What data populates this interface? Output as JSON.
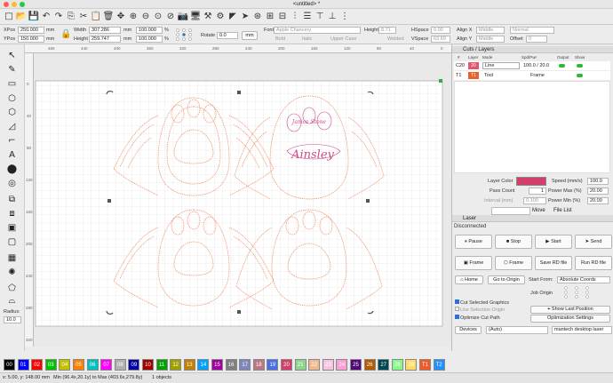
{
  "window": {
    "title": "<untitled> *"
  },
  "props": {
    "xpos_label": "XPos",
    "xpos": "250.000",
    "ypos_label": "YPos",
    "ypos": "150.000",
    "mm": "mm",
    "width_label": "Width",
    "width": "307.286",
    "height_label": "Height",
    "height": "259.747",
    "sx": "100.000",
    "sy": "100.000",
    "pct": "%",
    "rotate_label": "Rotate",
    "rotate": "0.0",
    "mm_btn": "mm",
    "font_label": "Font",
    "font": "Apple Chancery",
    "fheight_label": "Height",
    "fheight": "8.71",
    "bold": "Bold",
    "italic": "Italic",
    "upper": "Upper Case",
    "welded": "Welded",
    "hspace_label": "HSpace",
    "hspace": "0.00",
    "vspace_label": "VSpace",
    "vspace": "63.69",
    "alignx_label": "Align X",
    "alignx": "Middle",
    "aligny_label": "Align Y",
    "aligny": "Middle",
    "normal": "Normal",
    "offset_label": "Offset",
    "offset": "0"
  },
  "left": {
    "radius_label": "Radius:",
    "radius": "10.0"
  },
  "ruler": {
    "top": [
      "480",
      "440",
      "400",
      "360",
      "320",
      "280",
      "240",
      "200",
      "160",
      "120",
      "80",
      "40",
      "0"
    ],
    "left": [
      "0",
      "40",
      "80",
      "120",
      "160",
      "200",
      "240",
      "280",
      "320"
    ]
  },
  "layers": {
    "title": "Cuts / Layers",
    "headers": [
      "#",
      "Layer",
      "Mode",
      "Spd/Pwr",
      "Output",
      "Show"
    ],
    "rows": [
      {
        "num": "C20",
        "layer": "20",
        "mode": "Line",
        "spdpwr": "100.0 / 20.0",
        "color": "#e0586e"
      },
      {
        "num": "T1",
        "layer": "T1",
        "mode": "Tool",
        "spdpwr": "Frame",
        "color": "#e8602a"
      }
    ],
    "layer_color_label": "Layer Color",
    "pass_count_label": "Pass Count",
    "pass_count": "1",
    "interval_label": "Interval (mm)",
    "interval": "0.100",
    "speed_label": "Speed (mm/s)",
    "speed": "100.0",
    "pmax_label": "Power Max (%)",
    "pmax": "20.00",
    "pmin_label": "Power Min (%)",
    "pmin": "20.00",
    "tabs": [
      "Move",
      "File List"
    ]
  },
  "laser": {
    "title": "Laser",
    "status": "Disconnected",
    "pause": "Pause",
    "stop": "Stop",
    "start": "Start",
    "send": "Send",
    "frame": "Frame",
    "frame2": "Frame",
    "save_rd": "Save RD file",
    "run_rd": "Run RD file",
    "home": "Home",
    "goto": "Go to Origin",
    "start_from_label": "Start From:",
    "start_from": "Absolute Coords",
    "job_origin": "Job Origin",
    "cut_selected": "Cut Selected Graphics",
    "use_sel_origin": "Use Selection Origin",
    "optimize": "Optimize Cut Path",
    "show_last": "Show Last Position",
    "opt_settings": "Optimization Settings",
    "devices": "Devices",
    "auto": "(Auto)",
    "device_name": "mantech desktop laser"
  },
  "palette": [
    {
      "l": "00",
      "c": "#000000"
    },
    {
      "l": "01",
      "c": "#0000ff"
    },
    {
      "l": "02",
      "c": "#ff0000"
    },
    {
      "l": "03",
      "c": "#00c000"
    },
    {
      "l": "04",
      "c": "#c0c000"
    },
    {
      "l": "05",
      "c": "#ff8000"
    },
    {
      "l": "06",
      "c": "#00c0c0"
    },
    {
      "l": "07",
      "c": "#ff00ff"
    },
    {
      "l": "08",
      "c": "#b0b0b0"
    },
    {
      "l": "09",
      "c": "#0000a0"
    },
    {
      "l": "10",
      "c": "#a00000"
    },
    {
      "l": "11",
      "c": "#00a000"
    },
    {
      "l": "12",
      "c": "#a0a000"
    },
    {
      "l": "13",
      "c": "#c08000"
    },
    {
      "l": "14",
      "c": "#00a0ff"
    },
    {
      "l": "15",
      "c": "#a000a0"
    },
    {
      "l": "16",
      "c": "#808080"
    },
    {
      "l": "17",
      "c": "#7d87b9"
    },
    {
      "l": "18",
      "c": "#bb7784"
    },
    {
      "l": "19",
      "c": "#4a6fe3"
    },
    {
      "l": "20",
      "c": "#d33f6a"
    },
    {
      "l": "21",
      "c": "#8cd78c"
    },
    {
      "l": "22",
      "c": "#f0b98d"
    },
    {
      "l": "23",
      "c": "#f6c4e1"
    },
    {
      "l": "24",
      "c": "#fa9ed4"
    },
    {
      "l": "25",
      "c": "#500a78"
    },
    {
      "l": "26",
      "c": "#b45a00"
    },
    {
      "l": "27",
      "c": "#004754"
    },
    {
      "l": "28",
      "c": "#86fa88"
    },
    {
      "l": "29",
      "c": "#ffdb66"
    },
    {
      "l": "T1",
      "c": "#f05a28"
    },
    {
      "l": "T2",
      "c": "#1e90ff"
    }
  ],
  "canvas_text": {
    "name": "Janice Stone",
    "design": "Ainsley"
  },
  "status": {
    "coords": "x: 5.00, y: 148.00 mm",
    "range": "Min (96.4x,20.1y) to Max (403.6x,279.8y)",
    "objects": "1 objects"
  }
}
